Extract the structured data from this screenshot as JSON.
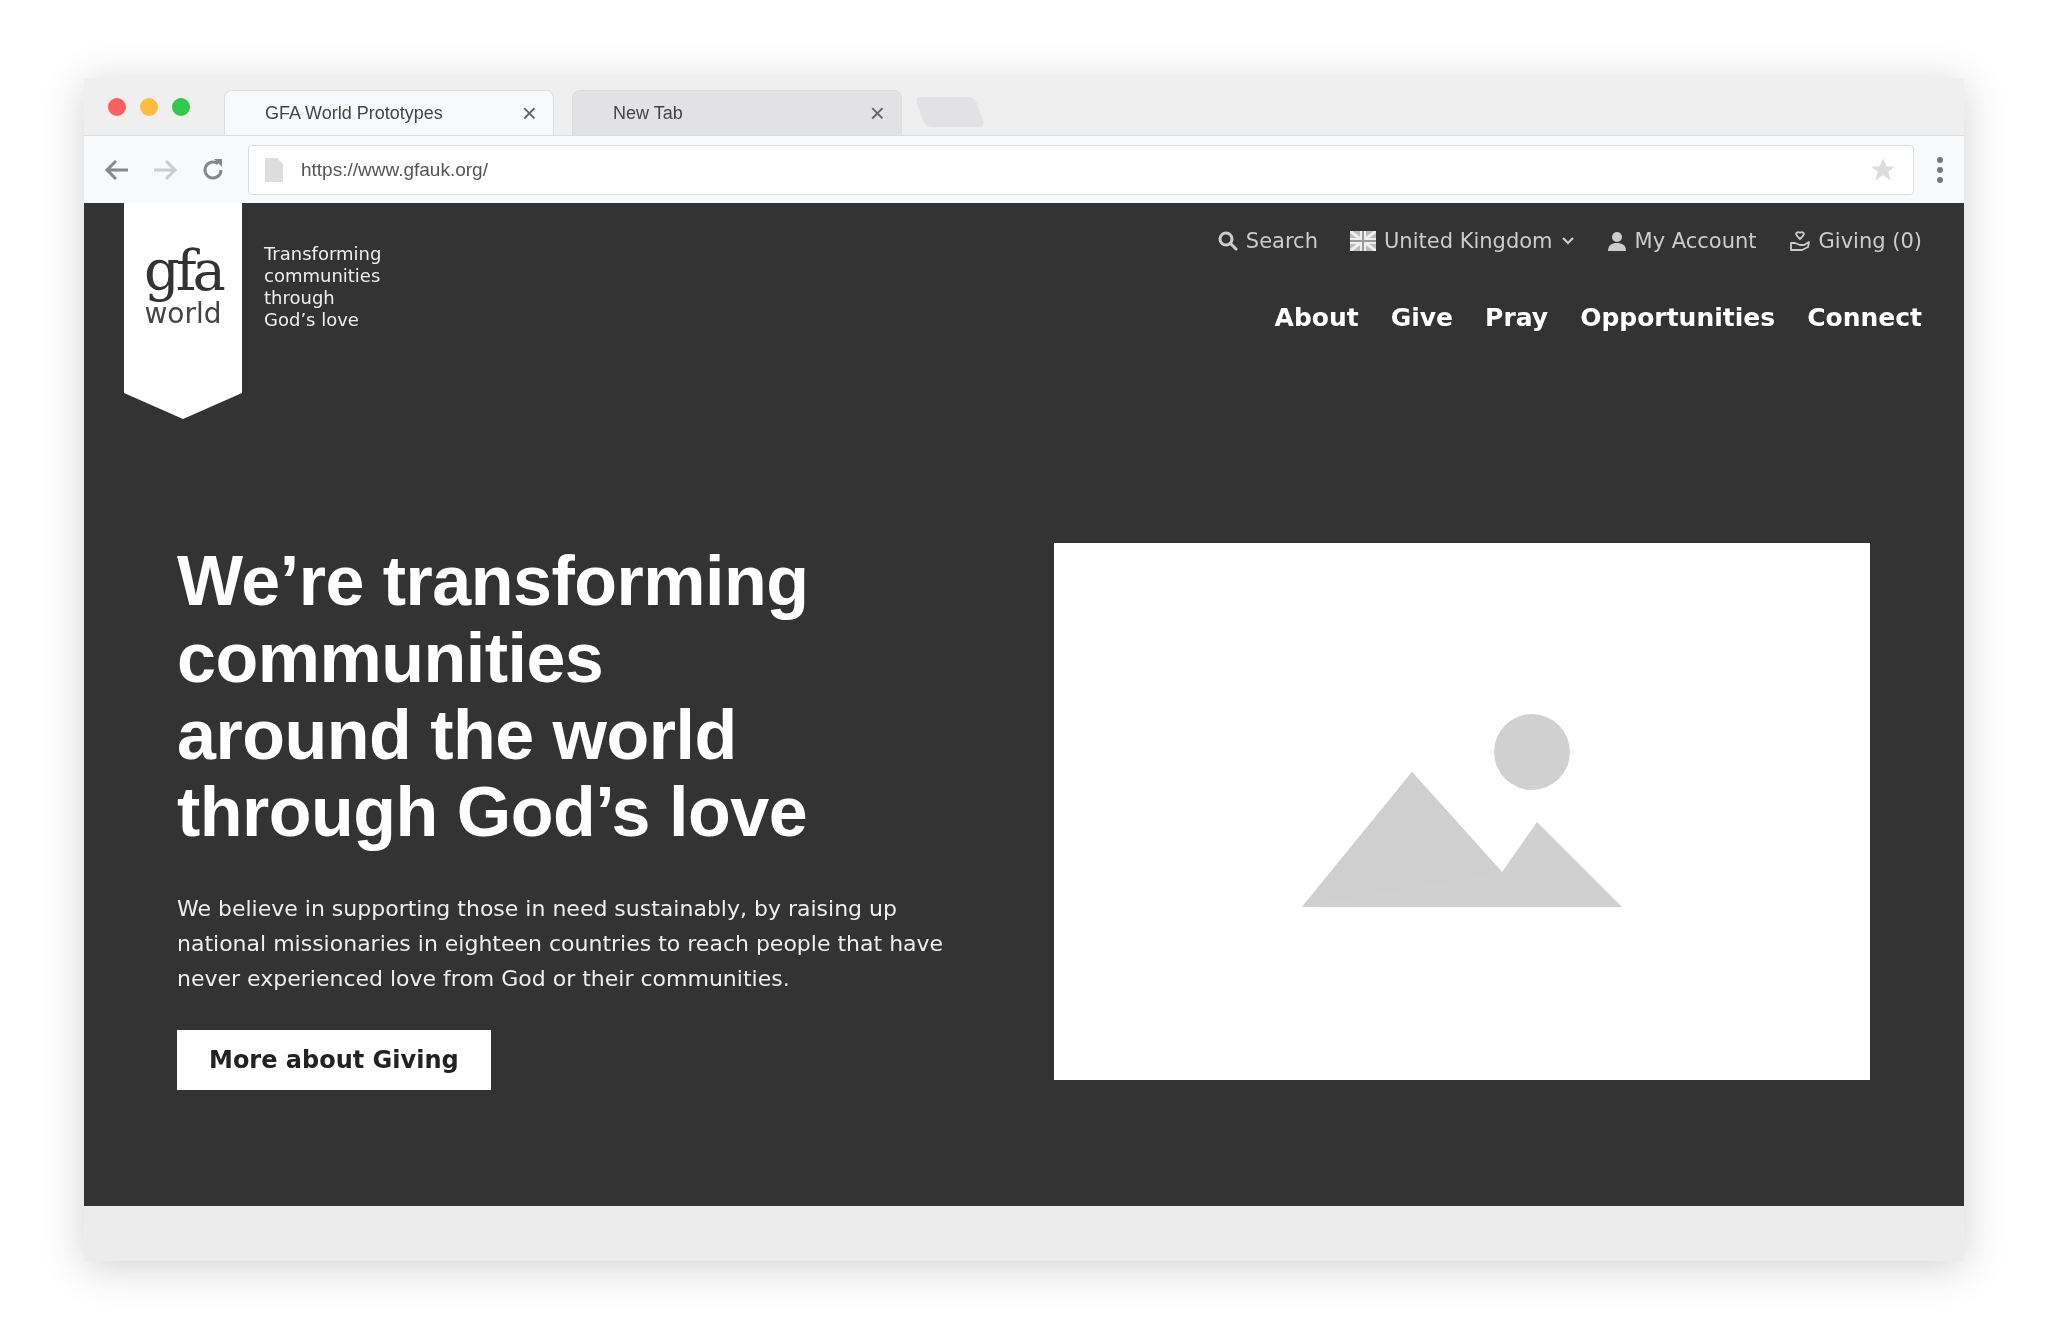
{
  "browser": {
    "tabs": [
      {
        "title": "GFA World Prototypes",
        "selected": true
      },
      {
        "title": "New Tab",
        "selected": false
      }
    ],
    "close_glyph": "×",
    "url": "https://www.gfauk.org/"
  },
  "header": {
    "logo": {
      "mark": "gfa",
      "word": "world"
    },
    "tagline_lines": [
      "Transforming",
      "communities",
      "through",
      "God’s love"
    ],
    "utility_links": [
      {
        "kind": "search",
        "label": "Search"
      },
      {
        "kind": "country",
        "label": "United Kingdom"
      },
      {
        "kind": "account",
        "label": "My Account"
      },
      {
        "kind": "giving",
        "label": "Giving (0)"
      }
    ],
    "nav": [
      "About",
      "Give",
      "Pray",
      "Opportunities",
      "Connect"
    ]
  },
  "hero": {
    "heading_lines": [
      "We’re transforming",
      "communities",
      "around the world",
      "through God’s love"
    ],
    "text": "We believe in supporting those in need sustainably, by raising up national missionaries in eighteen countries to reach people that have never experienced love from God or their communities.",
    "button": "More about Giving",
    "media": {
      "kind": "picture"
    }
  }
}
